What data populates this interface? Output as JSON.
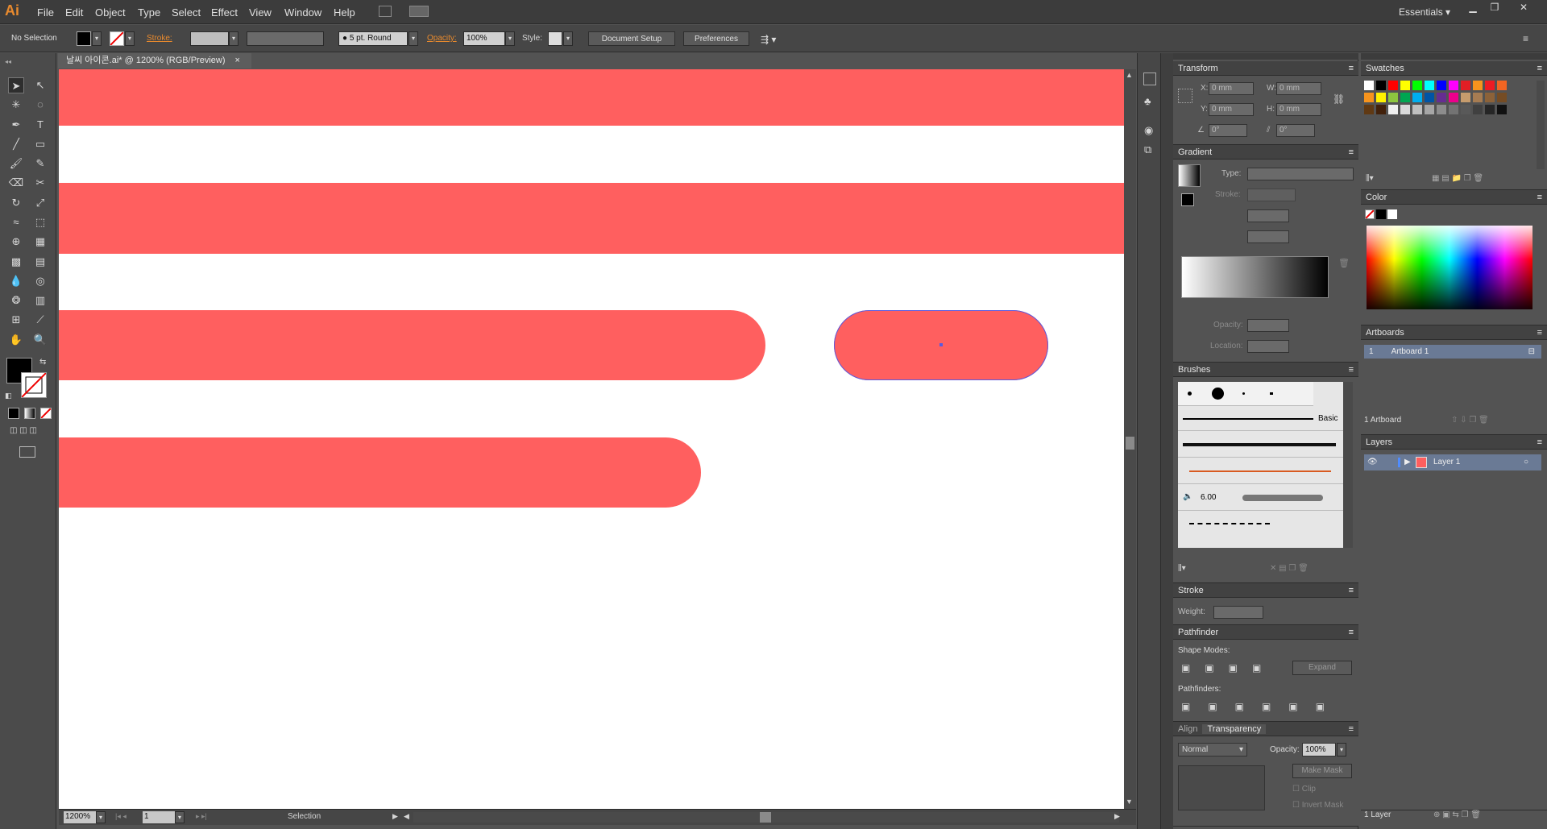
{
  "app": {
    "logo": "Ai",
    "workspace": "Essentials ▾"
  },
  "menu": [
    "File",
    "Edit",
    "Object",
    "Type",
    "Select",
    "Effect",
    "View",
    "Window",
    "Help"
  ],
  "control": {
    "selection": "No Selection",
    "stroke_label": "Stroke:",
    "brush": "5 pt. Round",
    "opacity_label": "Opacity:",
    "opacity": "100%",
    "style_label": "Style:",
    "doc_setup": "Document Setup",
    "preferences": "Preferences"
  },
  "doc": {
    "tab": "날씨 아이콘.ai* @ 1200% (RGB/Preview)",
    "close": "×"
  },
  "status": {
    "zoom": "1200%",
    "page": "1",
    "tool": "Selection"
  },
  "transform": {
    "title": "Transform",
    "x_label": "X:",
    "y_label": "Y:",
    "w_label": "W:",
    "h_label": "H:",
    "x": "0 mm",
    "y": "0 mm",
    "w": "0 mm",
    "h": "0 mm",
    "rot": "0°",
    "shear": "0°"
  },
  "gradient": {
    "title": "Gradient",
    "type_label": "Type:",
    "stroke_label": "Stroke:",
    "opacity_label": "Opacity:",
    "location_label": "Location:"
  },
  "brushes": {
    "title": "Brushes",
    "basic": "Basic",
    "size": "6.00"
  },
  "stroke": {
    "title": "Stroke",
    "weight_label": "Weight:"
  },
  "pathfinder": {
    "title": "Pathfinder",
    "shape_modes": "Shape Modes:",
    "pathfinders": "Pathfinders:",
    "expand": "Expand"
  },
  "transparency": {
    "align_tab": "Align",
    "title": "Transparency",
    "mode": "Normal",
    "opacity_label": "Opacity:",
    "opacity": "100%",
    "make_mask": "Make Mask",
    "clip": "Clip",
    "invert": "Invert Mask"
  },
  "swatches": {
    "title": "Swatches"
  },
  "color": {
    "title": "Color"
  },
  "artboards": {
    "title": "Artboards",
    "num": "1",
    "name": "Artboard 1",
    "count": "1 Artboard"
  },
  "layers": {
    "title": "Layers",
    "name": "Layer 1",
    "count": "1 Layer"
  },
  "colors": {
    "accent": "#ff5f5f",
    "bg": "#535353"
  }
}
